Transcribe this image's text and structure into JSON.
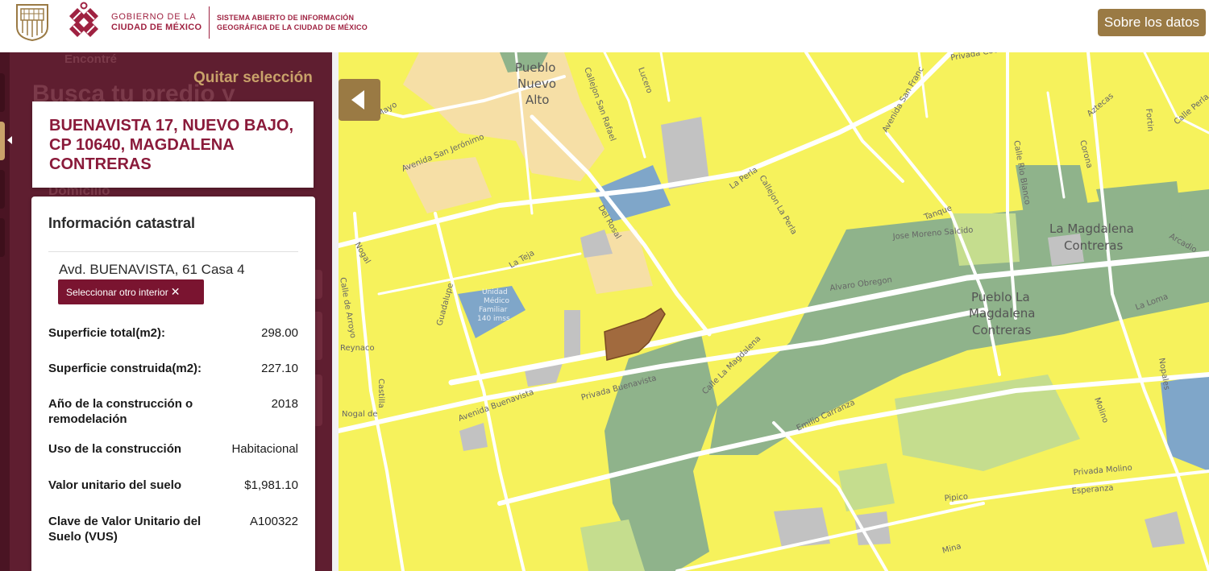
{
  "header": {
    "gov_line1": "GOBIERNO DE LA",
    "gov_line2": "CIUDAD DE MÉXICO",
    "system_line1": "SISTEMA ABIERTO DE INFORMACIÓN",
    "system_line2": "GEOGRÁFICA DE LA CIUDAD DE MÉXICO",
    "about_button": "Sobre los datos"
  },
  "sidebar": {
    "ghost_top": "Encontré",
    "ghost_heading": "Busca tu predio y",
    "ghost_domicilio": "Domicilio",
    "clear_selection": "Quitar selección",
    "address": "BUENAVISTA 17, NUEVO BAJO, CP 10640, MAGDALENA CONTRERAS"
  },
  "cadastral": {
    "title": "Información catastral",
    "unit": "Avd. BUENAVISTA, 61 Casa 4",
    "other_interior_button": "Seleccionar otro interior",
    "rows": [
      {
        "label": "Superficie total(m2):",
        "value": "298.00"
      },
      {
        "label": "Superficie construida(m2):",
        "value": "227.10"
      },
      {
        "label": "Año de la construcción o remodelación",
        "value": "2018"
      },
      {
        "label": "Uso de la construcción",
        "value": "Habitacional"
      },
      {
        "label": "Valor unitario del suelo",
        "value": "$1,981.10"
      },
      {
        "label": "Clave de Valor Unitario del Suelo (VUS)",
        "value": "A100322"
      }
    ]
  },
  "map": {
    "colors": {
      "base": "#f6f25c",
      "green": "#8fb38b",
      "light_green": "#c5dd8e",
      "blue": "#7fa6c9",
      "gray": "#c2c2c2",
      "peach": "#f6dfa6",
      "selected": "#a16a3e",
      "street": "#ffffff"
    },
    "labels": {
      "pueblo_nuevo_alto": [
        "Pueblo",
        "Nuevo",
        "Alto"
      ],
      "la_magdalena_contreras": [
        "La Magdalena",
        "Contreras"
      ],
      "pueblo_la_magdalena": [
        "Pueblo La",
        "Magdalena",
        "Contreras"
      ],
      "unidad_medico": [
        "Unidad",
        "Médico",
        "Familiar",
        "140 imss"
      ],
      "streets": {
        "avenida_san_jeronimo": "Avenida San Jerónimo",
        "callejon_san_rafael": "Callejon San Rafael",
        "avenida_san_francisco": "Avenida San Franc",
        "entrada_cocoa": "Privada Cocoa",
        "la_perla": "La Perla",
        "callejon_la_perla": "Callejon La Perla",
        "del_rosal": "Del Rosal",
        "la_teja": "La Teja",
        "guadalupe": "Guadalupe",
        "nogal": "Nogal",
        "calle_de_arroyo": "Calle de Arroyo",
        "reynaco": "Reynaco",
        "nogal_de": "Nogal de",
        "castilla": "Castilla",
        "avenida_buenavista": "Avenida Buenavista",
        "privada_buenavista": "Privada Buenavista",
        "calle_la_magdalena": "Calle La Magdalena",
        "alvaro_obregon": "Alvaro Obregon",
        "jose_moreno_salcido": "Jose Moreno Salcido",
        "emilio_carranza": "Emilio Carranza",
        "tanque": "Tanque",
        "calle_rio_blanco": "Calle Rio Blanco",
        "corona": "Corona",
        "aztecas": "Aztecas",
        "fortin": "Fortin",
        "calle_perla": "Calle Perla",
        "la_loma": "La Loma",
        "arcadio": "Arcadio",
        "molino": "Molino",
        "privada_molino": "Privada Molino",
        "esperanza": "Esperanza",
        "pipico": "Pipico",
        "mina": "Mina",
        "nopales": "Nopales",
        "lucero": "Lucero",
        "mayo": "Mayo"
      }
    }
  }
}
